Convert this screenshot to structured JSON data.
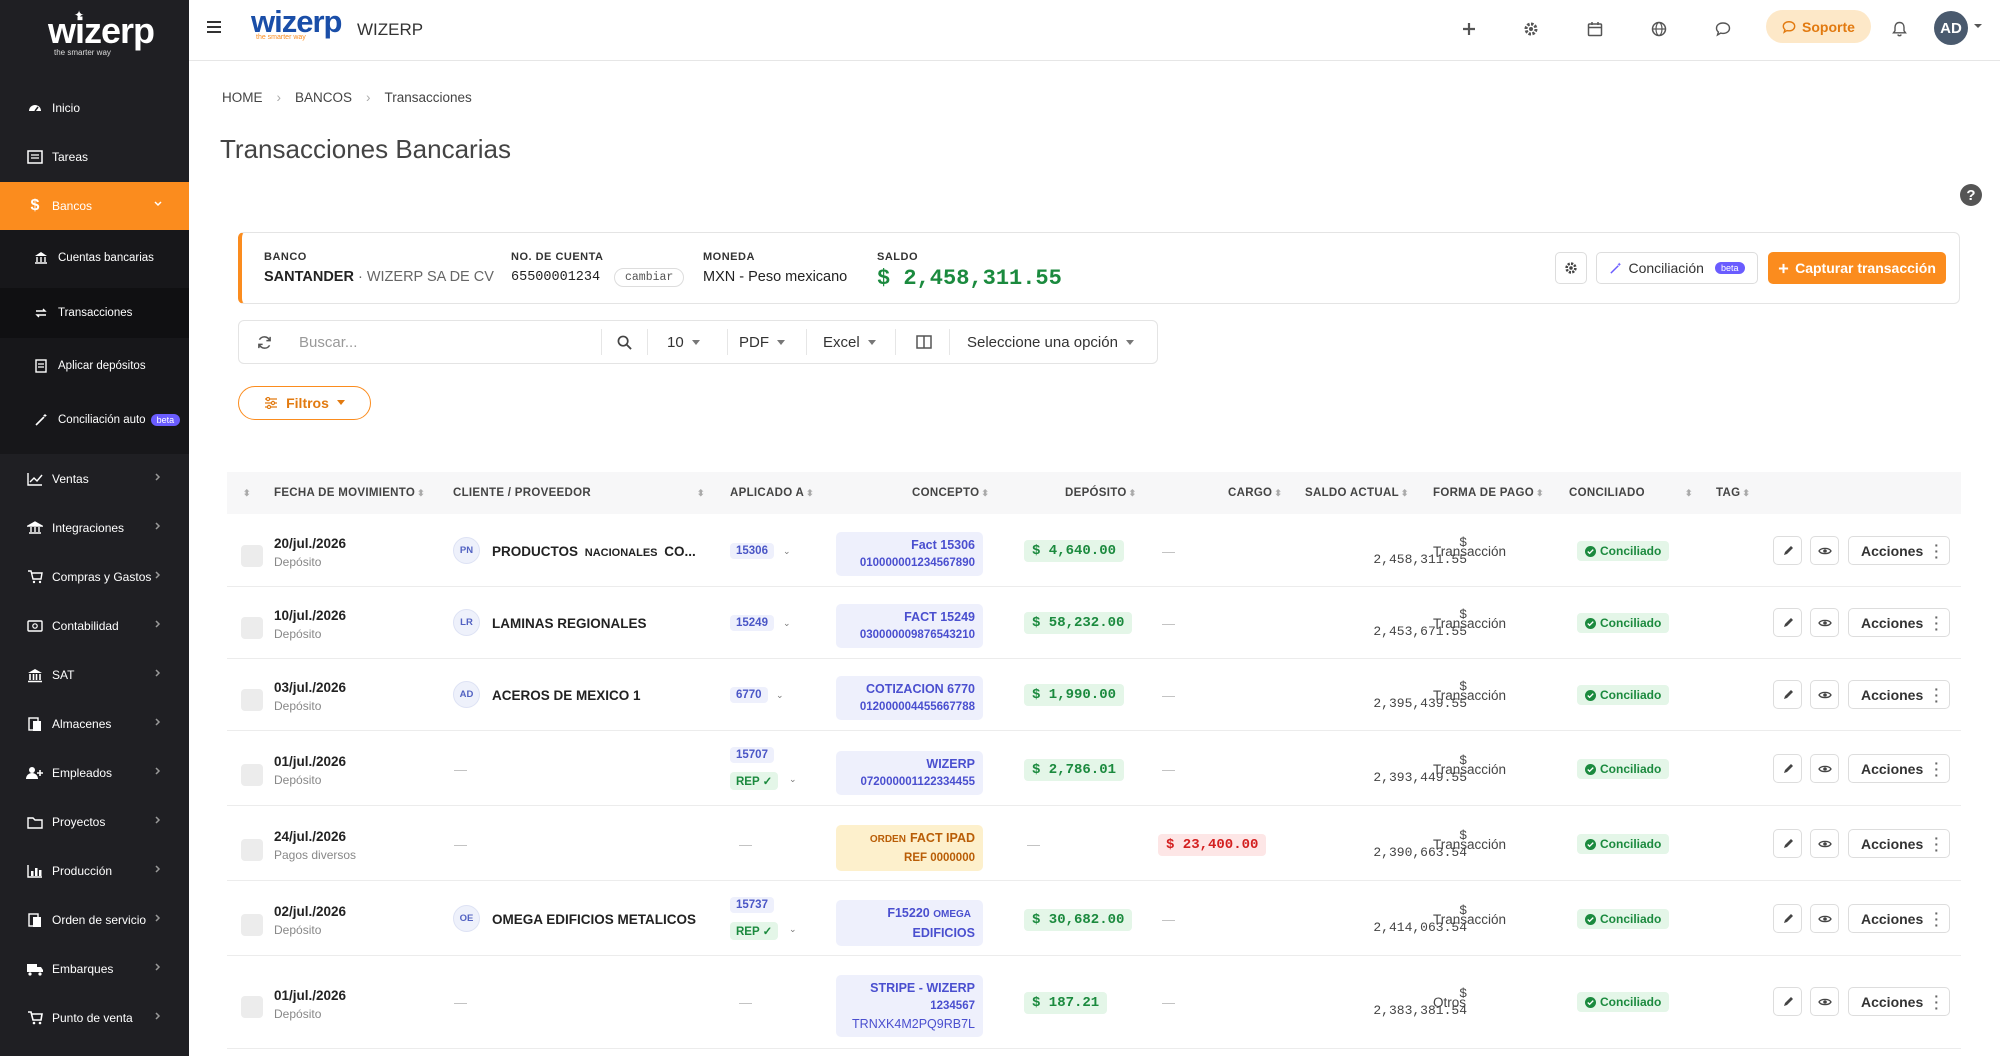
{
  "sidebar": {
    "logo_text": "wizerp",
    "logo_tagline": "the smarter way",
    "items": [
      {
        "label": "Inicio",
        "icon": "dashboard-icon"
      },
      {
        "label": "Tareas",
        "icon": "tasks-icon"
      },
      {
        "label": "Bancos",
        "icon": "dollar-icon",
        "active": true
      },
      {
        "label": "Ventas",
        "icon": "chart-line-icon"
      },
      {
        "label": "Integraciones",
        "icon": "integrations-icon"
      },
      {
        "label": "Compras y Gastos",
        "icon": "cart-icon"
      },
      {
        "label": "Contabilidad",
        "icon": "accounting-icon"
      },
      {
        "label": "SAT",
        "icon": "bank-building-icon"
      },
      {
        "label": "Almacenes",
        "icon": "warehouse-icon"
      },
      {
        "label": "Empleados",
        "icon": "employees-icon"
      },
      {
        "label": "Proyectos",
        "icon": "folder-icon"
      },
      {
        "label": "Producción",
        "icon": "production-icon"
      },
      {
        "label": "Orden de servicio",
        "icon": "service-order-icon"
      },
      {
        "label": "Embarques",
        "icon": "truck-icon"
      },
      {
        "label": "Punto de venta",
        "icon": "pos-icon"
      }
    ],
    "subitems": [
      {
        "label": "Cuentas bancarias",
        "icon": "bank-icon"
      },
      {
        "label": "Transacciones",
        "icon": "transactions-icon",
        "current": true
      },
      {
        "label": "Aplicar depósitos",
        "icon": "receipt-icon"
      },
      {
        "label": "Conciliación auto",
        "icon": "magic-wand-icon",
        "badge": "beta"
      }
    ]
  },
  "topbar": {
    "logo_text": "wizerp",
    "logo_tagline": "the smarter way",
    "app_name": "WIZERP",
    "support_label": "Soporte",
    "avatar_initials": "AD"
  },
  "breadcrumb": [
    "HOME",
    "BANCOS",
    "Transacciones"
  ],
  "page_title": "Transacciones Bancarias",
  "bank": {
    "banco_label": "BANCO",
    "banco_value": "SANTANDER",
    "banco_company": "· WIZERP SA DE CV",
    "cuenta_label": "NO. DE CUENTA",
    "cuenta_value": "65500001234",
    "cambiar_label": "cambiar",
    "moneda_label": "MONEDA",
    "moneda_value": "MXN - Peso mexicano",
    "saldo_label": "SALDO",
    "saldo_value": "$ 2,458,311.55",
    "conciliacion_label": "Conciliación",
    "conciliacion_badge": "beta",
    "capturar_label": "Capturar transacción"
  },
  "toolbar": {
    "search_placeholder": "Buscar...",
    "page_size": "10",
    "pdf_label": "PDF",
    "excel_label": "Excel",
    "select_label": "Seleccione una opción"
  },
  "filtros_label": "Filtros",
  "table": {
    "headers": {
      "fecha": "FECHA DE MOVIMIENTO",
      "cliente": "CLIENTE / PROVEEDOR",
      "aplicado": "APLICADO A",
      "concepto": "CONCEPTO",
      "deposito": "DEPÓSITO",
      "cargo": "CARGO",
      "saldo": "SALDO ACTUAL",
      "forma": "FORMA DE PAGO",
      "conciliado": "CONCILIADO",
      "tag": "TAG"
    },
    "dash": "—",
    "acciones_label": "Acciones",
    "rows": [
      {
        "date": "20/jul./2026",
        "type": "Depósito",
        "initials": "PN",
        "client_a": "PRODUCTOS",
        "client_b": "NACIONALES",
        "client_c": "CO...",
        "applied": "15306",
        "rep": "",
        "concept_l1": "Fact 15306",
        "concept_l1_small": "",
        "concept_l2": "010000001234567890",
        "concept_l3": "",
        "deposit": "$ 4,640.00",
        "charge": "",
        "saldo_sym": "$",
        "saldo_val": "2,458,311.55",
        "forma": "Transacción",
        "conciliado": "Conciliado"
      },
      {
        "date": "10/jul./2026",
        "type": "Depósito",
        "initials": "LR",
        "client_a": "LAMINAS",
        "client_b": "",
        "client_c": "REGIONALES",
        "applied": "15249",
        "rep": "",
        "concept_l1": "FACT 15249",
        "concept_l1_small": "",
        "concept_l2": "030000009876543210",
        "concept_l3": "",
        "deposit": "$ 58,232.00",
        "charge": "",
        "saldo_sym": "$",
        "saldo_val": "2,453,671.55",
        "forma": "Transacción",
        "conciliado": "Conciliado"
      },
      {
        "date": "03/jul./2026",
        "type": "Depósito",
        "initials": "AD",
        "client_a": "ACEROS",
        "client_b": "",
        "client_c": "DE MEXICO 1",
        "applied": "6770",
        "rep": "",
        "concept_l1": "COTIZACION 6770",
        "concept_l1_small": "",
        "concept_l2": "012000004455667788",
        "concept_l3": "",
        "deposit": "$ 1,990.00",
        "charge": "",
        "saldo_sym": "$",
        "saldo_val": "2,395,439.55",
        "forma": "Transacción",
        "conciliado": "Conciliado"
      },
      {
        "date": "01/jul./2026",
        "type": "Depósito",
        "initials": "",
        "client_a": "",
        "client_b": "",
        "client_c": "",
        "applied": "15707",
        "rep": "REP ✓",
        "concept_l1": "WIZERP",
        "concept_l1_small": "",
        "concept_l2": "072000001122334455",
        "concept_l3": "",
        "deposit": "$ 2,786.01",
        "charge": "",
        "saldo_sym": "$",
        "saldo_val": "2,393,449.55",
        "forma": "Transacción",
        "conciliado": "Conciliado"
      },
      {
        "date": "24/jul./2026",
        "type": "Pagos diversos",
        "initials": "",
        "client_a": "",
        "client_b": "",
        "client_c": "",
        "applied": "",
        "rep": "",
        "concept_l1": "FACT IPAD",
        "concept_l1_small": "ORDEN",
        "concept_l2": "REF 0000000",
        "concept_l3": "",
        "deposit": "",
        "charge": "$ 23,400.00",
        "saldo_sym": "$",
        "saldo_val": "2,390,663.54",
        "forma": "Transacción",
        "conciliado": "Conciliado"
      },
      {
        "date": "02/jul./2026",
        "type": "Depósito",
        "initials": "OE",
        "client_a": "OMEGA",
        "client_b": "",
        "client_c": "EDIFICIOS METALICOS",
        "applied": "15737",
        "rep": "REP ✓",
        "concept_l1": "F15220",
        "concept_l1_small": "OMEGA",
        "concept_l2": "EDIFICIOS",
        "concept_l3": "",
        "deposit": "$ 30,682.00",
        "charge": "",
        "saldo_sym": "$",
        "saldo_val": "2,414,063.54",
        "forma": "Transacción",
        "conciliado": "Conciliado"
      },
      {
        "date": "01/jul./2026",
        "type": "Depósito",
        "initials": "",
        "client_a": "",
        "client_b": "",
        "client_c": "",
        "applied": "",
        "rep": "",
        "concept_l1": "STRIPE - WIZERP",
        "concept_l1_small": "",
        "concept_l2": "1234567",
        "concept_l3": "TRNXK4M2PQ9RB7L",
        "deposit": "$ 187.21",
        "charge": "",
        "saldo_sym": "$",
        "saldo_val": "2,383,381.54",
        "forma": "Otros",
        "conciliado": "Conciliado"
      }
    ]
  },
  "colors": {
    "accent": "#fb8c1e",
    "sidebar_bg": "#1f1f23",
    "success": "#1b8a3e",
    "danger": "#d32020",
    "link": "#4a4fcf"
  }
}
